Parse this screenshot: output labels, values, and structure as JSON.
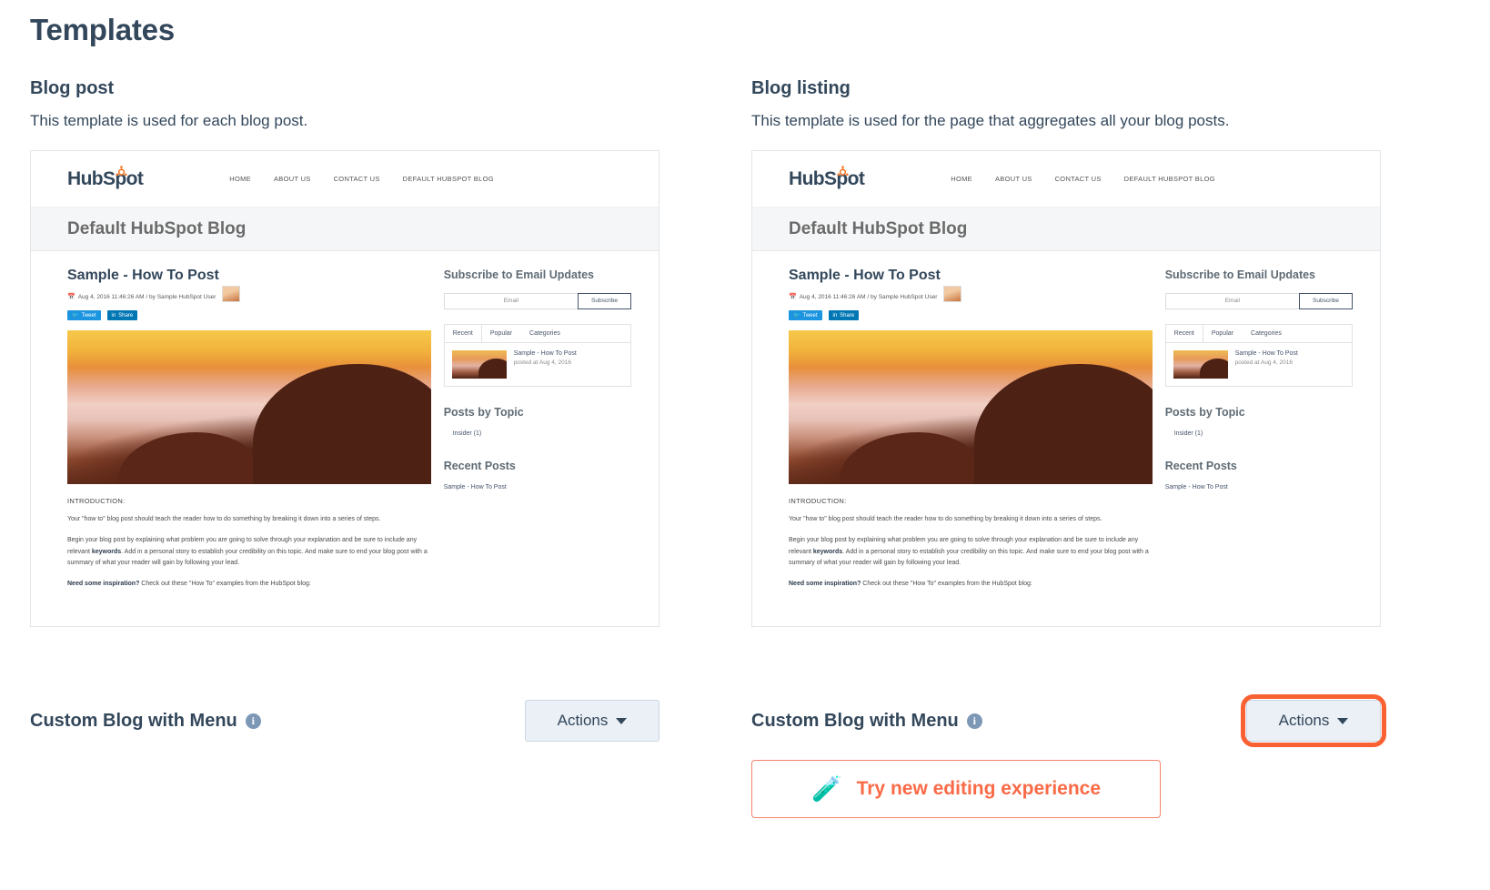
{
  "page": {
    "title": "Templates"
  },
  "columns": [
    {
      "key": "blog_post",
      "title": "Blog post",
      "description": "This template is used for each blog post.",
      "template_name": "Custom Blog with Menu",
      "info_icon": "info-icon",
      "actions_label": "Actions",
      "actions_highlighted": false,
      "has_try_banner": false
    },
    {
      "key": "blog_listing",
      "title": "Blog listing",
      "description": "This template is used for the page that aggregates all your blog posts.",
      "template_name": "Custom Blog with Menu",
      "info_icon": "info-icon",
      "actions_label": "Actions",
      "actions_highlighted": true,
      "has_try_banner": true
    }
  ],
  "try_banner": {
    "emoji": "🧪",
    "icon_name": "test-tube-icon",
    "label": "Try new editing experience"
  },
  "preview": {
    "logo_text": "HubSpot",
    "nav_items": [
      "HOME",
      "ABOUT US",
      "CONTACT US",
      "DEFAULT HUBSPOT BLOG"
    ],
    "banner_title": "Default HubSpot Blog",
    "post": {
      "title": "Sample - How To Post",
      "meta": "Aug 4, 2016 11:46:26 AM / by Sample HubSpot User",
      "tweet_label": "Tweet",
      "share_label": "Share",
      "intro_heading": "INTRODUCTION:",
      "paragraph_1": "Your \"how to\" blog post should teach the reader how to do something by breaking it down into a series of steps.",
      "paragraph_2_a": "Begin your blog post by explaining what problem you are going to solve through your explanation and be sure to include any relevant ",
      "paragraph_2_keyword": "keywords",
      "paragraph_2_b": ". Add in a personal story to establish your credibility on this topic. And make sure to end your blog post with a summary of what your reader will gain by following your lead.",
      "paragraph_3_a": "Need some inspiration?",
      "paragraph_3_b": " Check out these \"How To\" examples from the HubSpot blog:"
    },
    "sidebar": {
      "subscribe_title": "Subscribe to Email Updates",
      "email_placeholder": "Email",
      "subscribe_button": "Subscribe",
      "tabs": [
        "Recent",
        "Popular",
        "Categories"
      ],
      "recent_item_title": "Sample - How To Post",
      "recent_item_date": "posted at Aug 4, 2016",
      "topics_title": "Posts by Topic",
      "topic_item": "Insider (1)",
      "recent_posts_title": "Recent Posts",
      "recent_post_link": "Sample - How To Post"
    }
  },
  "colors": {
    "text": "#33475b",
    "highlight": "#f96032",
    "accent_orange": "#fa6a46",
    "button_bg": "#eaf0f6",
    "button_border": "#cbd6e2"
  }
}
